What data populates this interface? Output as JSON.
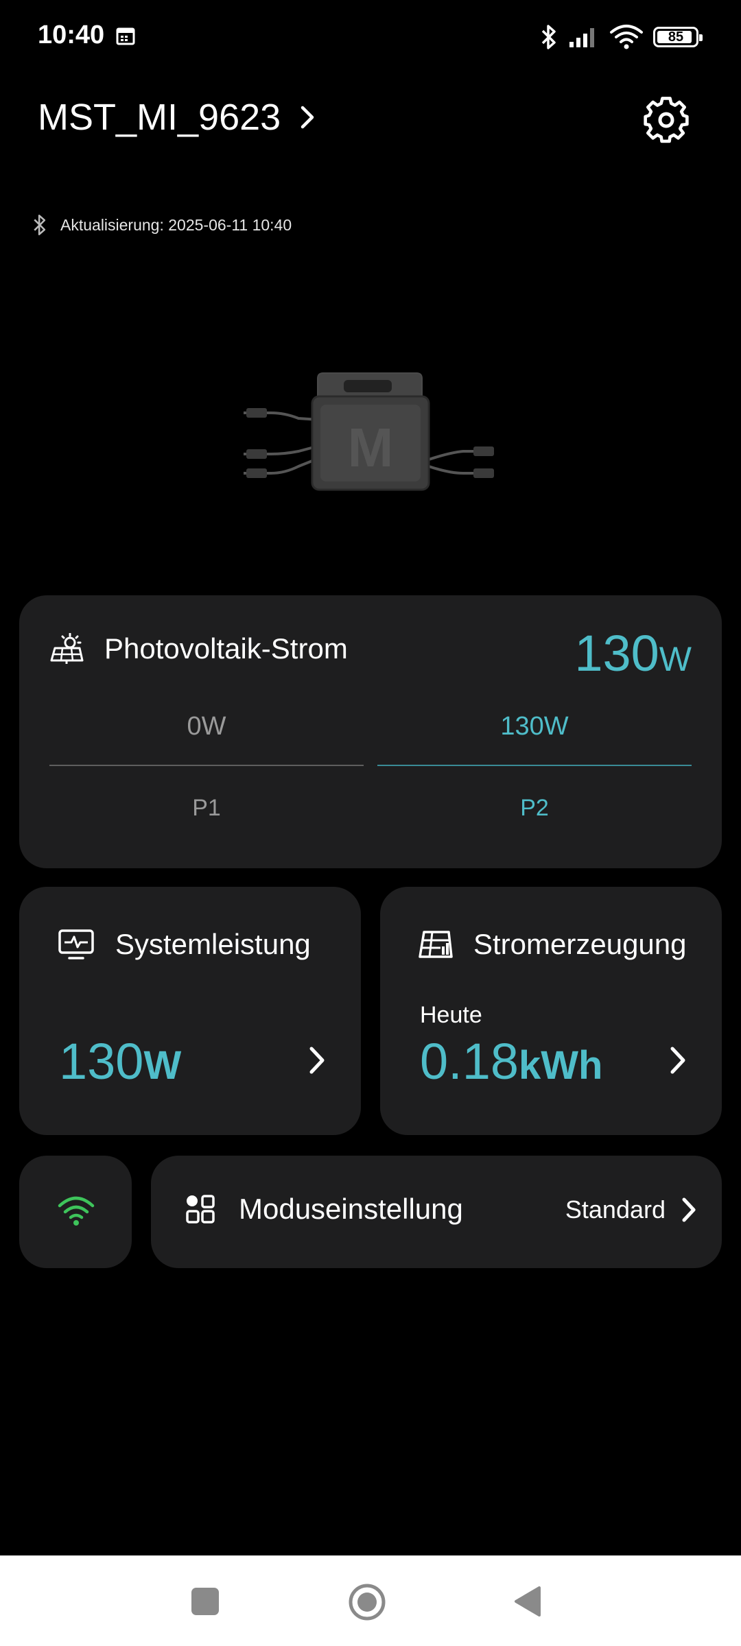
{
  "status_bar": {
    "time": "10:40",
    "battery": "85",
    "icons": [
      "calendar-icon",
      "bluetooth-icon",
      "signal-icon",
      "wifi-icon",
      "battery-icon"
    ]
  },
  "header": {
    "device_name": "MST_MI_9623",
    "settings_icon": "gear-icon"
  },
  "update": {
    "text": "Aktualisierung: 2025-06-11 10:40"
  },
  "pv_card": {
    "title": "Photovoltaik-Strom",
    "total_value": "130",
    "total_unit": "W",
    "channels": [
      {
        "value": "0W",
        "label": "P1"
      },
      {
        "value": "130W",
        "label": "P2"
      }
    ]
  },
  "system_card": {
    "title": "Systemleistung",
    "value": "130",
    "unit": "W"
  },
  "generation_card": {
    "title": "Stromerzeugung",
    "period": "Heute",
    "value": "0.18",
    "unit": "kWh"
  },
  "mode_card": {
    "title": "Moduseinstellung",
    "value": "Standard"
  },
  "colors": {
    "accent": "#4fbdc9",
    "card_bg": "#1e1e1f",
    "wifi_green": "#3ec45b",
    "background": "#000000"
  }
}
